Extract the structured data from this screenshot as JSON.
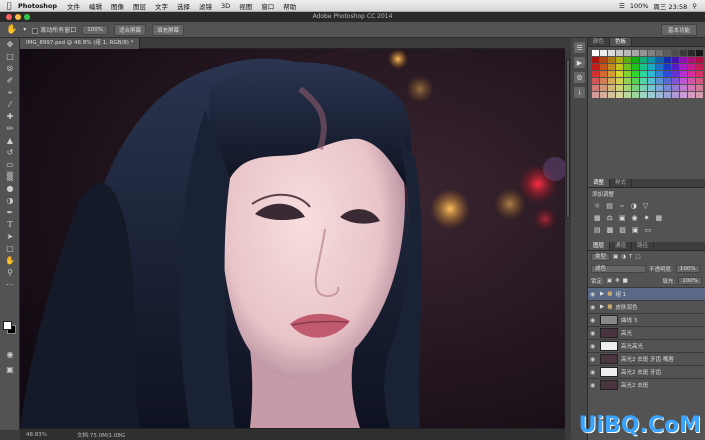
{
  "menubar": {
    "app": "Photoshop",
    "items": [
      "文件",
      "编辑",
      "图像",
      "图层",
      "文字",
      "选择",
      "滤镜",
      "3D",
      "视图",
      "窗口",
      "帮助"
    ],
    "clock": "周三 23:58",
    "battery": "100%"
  },
  "window_title": "Adobe Photoshop CC 2014",
  "options": {
    "scroll_all": "滚动所有窗口",
    "zoom_100": "100%",
    "fit_screen": "适合屏幕",
    "fill_screen": "填充屏幕",
    "workspace": "基本功能"
  },
  "document": {
    "tab_label": "IMG_8997.psd @ 48.8% (组 1, RGB/8) *"
  },
  "status": {
    "zoom": "48.83%",
    "doc_size": "文档:75.0M/1.08G"
  },
  "panels": {
    "color_tab": "颜色",
    "swatches_tab": "色板",
    "adjust_tab": "调整",
    "styles_tab": "样式",
    "add_adjust": "添加调整",
    "layers_tab": "图层",
    "channels_tab": "通道",
    "paths_tab": "路径",
    "kind_filter": "类型",
    "blend_mode": "滤色",
    "opacity_label": "不透明度:",
    "opacity_value": "100%",
    "lock_label": "锁定:",
    "fill_label": "填充:",
    "fill_value": "100%"
  },
  "layers": [
    {
      "name": "组 1",
      "type": "group",
      "active": true
    },
    {
      "name": "皮肤润色",
      "type": "group",
      "active": false
    },
    {
      "name": "曲线 3",
      "type": "adjust",
      "active": false
    },
    {
      "name": "高光",
      "type": "pixel",
      "active": false
    },
    {
      "name": "高光高光",
      "type": "pixel",
      "active": false
    },
    {
      "name": "高光2 去斑 牙齿 嘴唇",
      "type": "pixel",
      "active": false
    },
    {
      "name": "高光2 去斑 牙齿",
      "type": "pixel",
      "active": false
    },
    {
      "name": "高光2 去斑",
      "type": "pixel",
      "active": false
    }
  ],
  "watermark": "UiBQ.CoM"
}
